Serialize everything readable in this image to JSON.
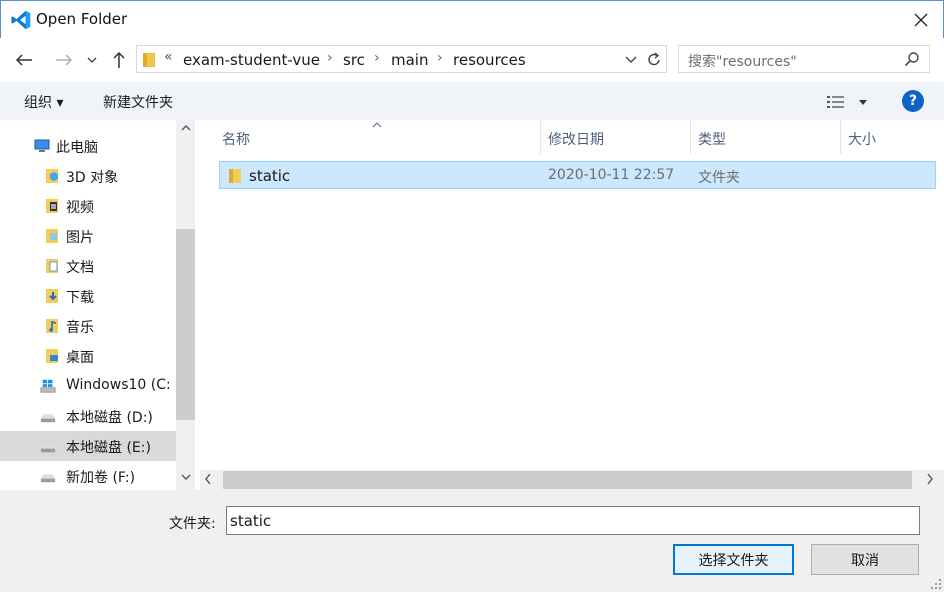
{
  "window": {
    "title": "Open Folder",
    "icon": "vscode-icon"
  },
  "nav": {
    "back_icon": "arrow-left-icon",
    "forward_icon": "arrow-right-icon",
    "recent_icon": "chevron-down-icon",
    "up_icon": "arrow-up-icon"
  },
  "address": {
    "overflow": "«",
    "crumbs": [
      "exam-student-vue",
      "src",
      "main",
      "resources"
    ],
    "separator": "›"
  },
  "search": {
    "placeholder": "搜索\"resources\""
  },
  "toolbar": {
    "organize_label": "组织 ▾",
    "new_folder_label": "新建文件夹",
    "help_label": "?"
  },
  "sidebar": {
    "items": [
      {
        "label": "此电脑",
        "icon": "computer-icon"
      },
      {
        "label": "3D 对象",
        "icon": "3d-objects-icon"
      },
      {
        "label": "视频",
        "icon": "video-folder-icon"
      },
      {
        "label": "图片",
        "icon": "pictures-folder-icon"
      },
      {
        "label": "文档",
        "icon": "documents-folder-icon"
      },
      {
        "label": "下载",
        "icon": "downloads-folder-icon"
      },
      {
        "label": "音乐",
        "icon": "music-folder-icon"
      },
      {
        "label": "桌面",
        "icon": "desktop-folder-icon"
      },
      {
        "label": "Windows10 (C:",
        "icon": "windows-drive-icon"
      },
      {
        "label": "本地磁盘 (D:)",
        "icon": "drive-icon"
      },
      {
        "label": "本地磁盘 (E:)",
        "icon": "drive-icon",
        "selected": true
      },
      {
        "label": "新加卷 (F:)",
        "icon": "drive-icon"
      }
    ]
  },
  "columns": {
    "name": "名称",
    "modified": "修改日期",
    "type": "类型",
    "size": "大小"
  },
  "files": [
    {
      "name": "static",
      "modified": "2020-10-11 22:57",
      "type": "文件夹",
      "size": "",
      "selected": true
    }
  ],
  "footer": {
    "folder_label": "文件夹:",
    "folder_value": "static",
    "select_button": "选择文件夹",
    "cancel_button": "取消"
  },
  "colors": {
    "accent": "#0078d7",
    "selection_bg": "#cce8ff",
    "selection_border": "#99d1ff",
    "toolbar_bg": "#f0f4f9"
  }
}
